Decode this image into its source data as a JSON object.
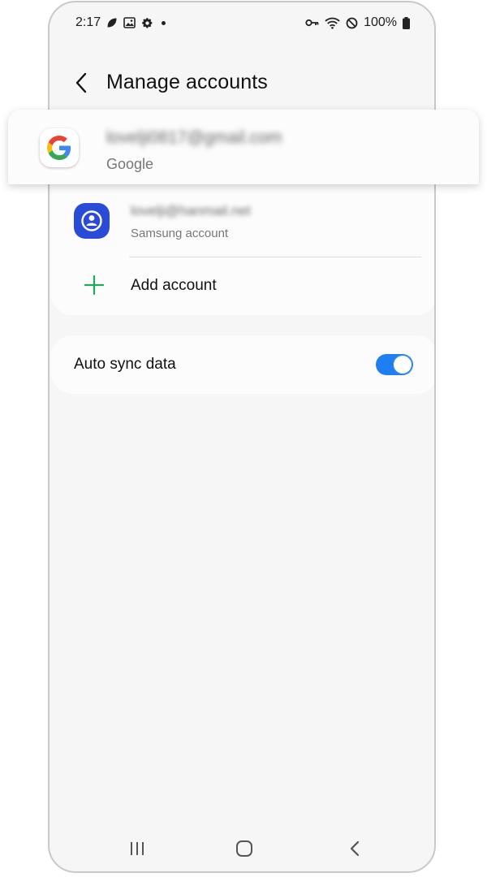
{
  "status_bar": {
    "time": "2:17",
    "battery": "100%"
  },
  "header": {
    "title": "Manage accounts"
  },
  "accounts": [
    {
      "email": "lovelji0817@gmail.com",
      "provider": "Google"
    },
    {
      "email": "lovelji@hanmail.net",
      "provider": "Samsung account"
    }
  ],
  "add_account": {
    "label": "Add account"
  },
  "sync": {
    "label": "Auto sync data",
    "enabled": true
  },
  "colors": {
    "accent": "#1f7ff0",
    "samsung_blue": "#2a4bd7",
    "add_green": "#1faa59",
    "background": "#f6f6f6"
  },
  "icons": {
    "back": "chevron-left-icon",
    "add": "plus-icon",
    "nav_recent": "recent-apps-icon",
    "nav_home": "home-icon",
    "nav_back": "back-icon"
  }
}
